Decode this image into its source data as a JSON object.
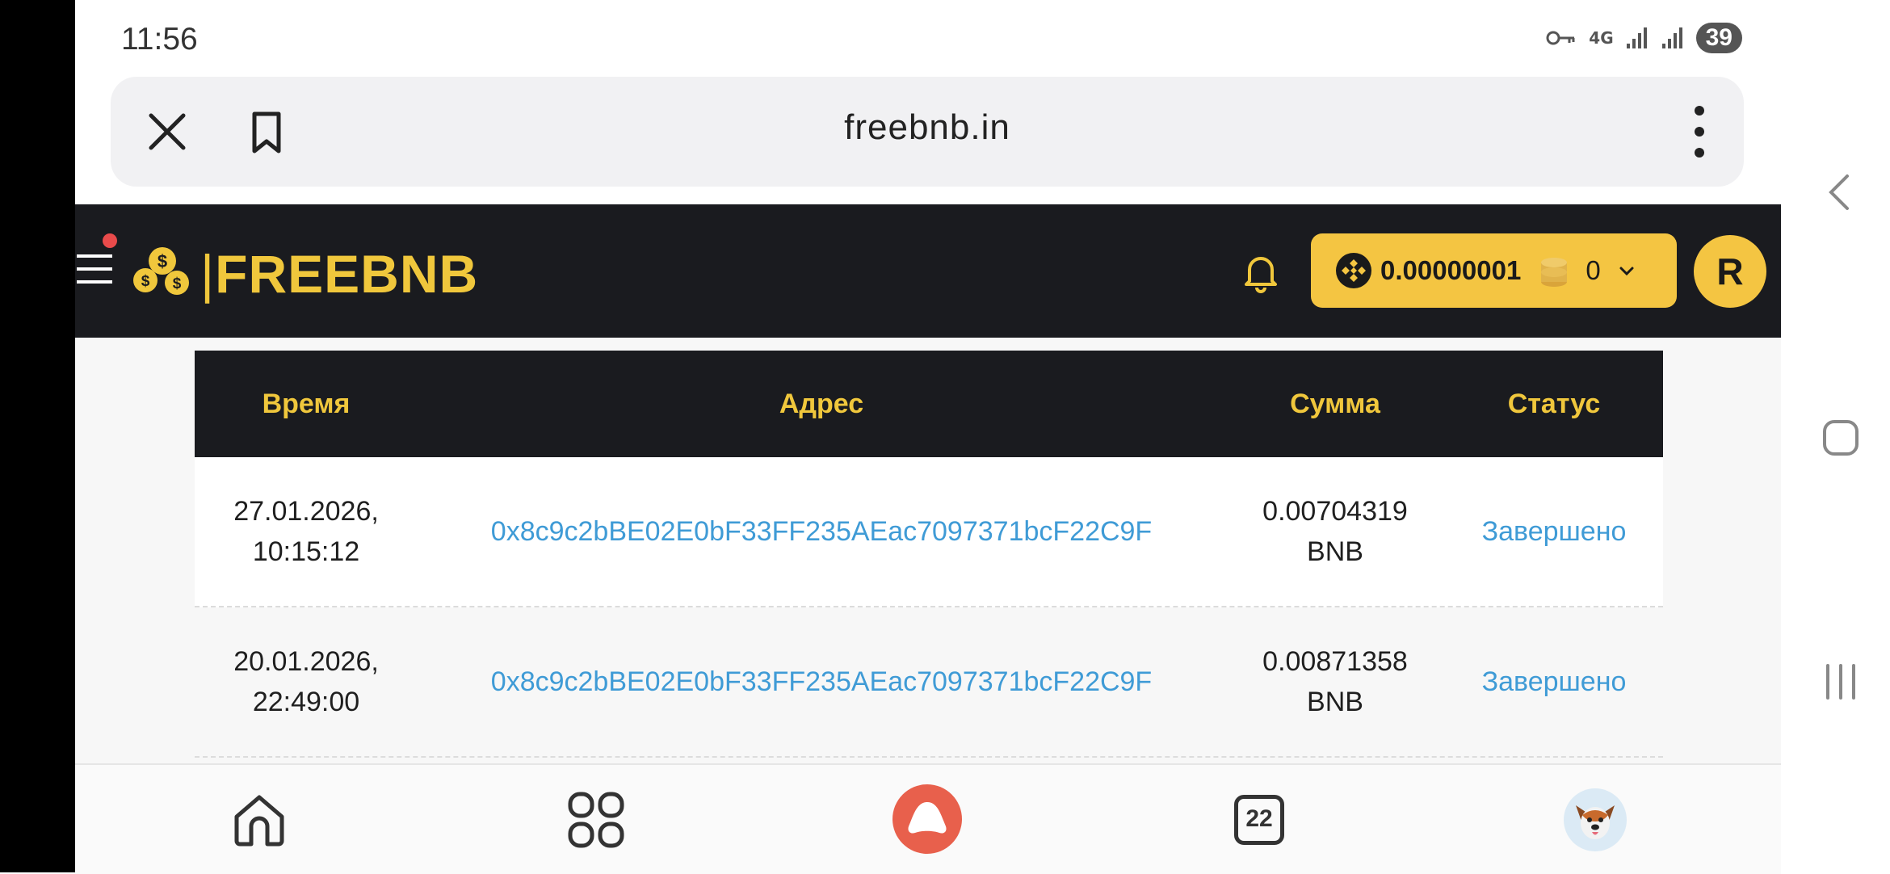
{
  "status_bar": {
    "time": "11:56",
    "network": "4G",
    "battery": "39",
    "icons": [
      "vpn-key-icon",
      "network-4g-icon",
      "signal-icon",
      "signal-icon",
      "battery-icon"
    ]
  },
  "browser": {
    "url": "freebnb.in",
    "close_icon": "close-icon",
    "bookmark_icon": "bookmark-icon",
    "menu_icon": "more-vertical-icon"
  },
  "site_header": {
    "logo_text": "FREEBNB",
    "balance": "0.00000001",
    "coins": "0",
    "avatar_letter": "R",
    "brand_color": "#f0c73c",
    "pill_color": "#f4c542",
    "header_bg": "#1a1b1f"
  },
  "table": {
    "headers": [
      "Время",
      "Адрес",
      "Сумма",
      "Статус"
    ],
    "rows": [
      {
        "time_date": "27.01.2026,",
        "time_clock": "10:15:12",
        "address": "0x8c9c2bBE02E0bF33FF235AEac7097371bcF22C9F",
        "amount": "0.00704319",
        "currency": "BNB",
        "status": "Завершено"
      },
      {
        "time_date": "20.01.2026,",
        "time_clock": "22:49:00",
        "address": "0x8c9c2bBE02E0bF33FF235AEac7097371bcF22C9F",
        "amount": "0.00871358",
        "currency": "BNB",
        "status": "Завершено"
      }
    ],
    "link_color": "#3f9bd6"
  },
  "bottom_nav": {
    "items": [
      "home-icon",
      "apps-icon",
      "alice-assistant-icon",
      "tabs-icon",
      "profile-avatar-icon"
    ],
    "tabs_count": "22",
    "assistant_color": "#e8604c"
  },
  "system_nav": [
    "back-icon",
    "home-icon",
    "recents-icon"
  ]
}
